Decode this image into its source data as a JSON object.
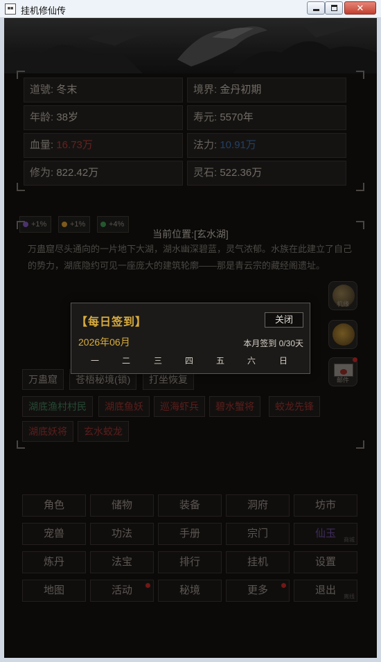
{
  "window": {
    "title": "挂机修仙传",
    "icon": "app-icon",
    "min_glyph": "—",
    "max_glyph": "□",
    "close_glyph": "✕"
  },
  "character": {
    "daohao": {
      "label": "道號:",
      "value": "冬末"
    },
    "jingjie": {
      "label": "境界:",
      "value": "金丹初期"
    },
    "age": {
      "label": "年龄:",
      "value": "38岁"
    },
    "lifespan": {
      "label": "寿元:",
      "value": "5570年"
    },
    "hp": {
      "label": "血量:",
      "value": "16.73万",
      "color": "#7a2a26"
    },
    "mana": {
      "label": "法力:",
      "value": "10.91万",
      "color": "#2b4f7b"
    },
    "cultivation": {
      "label": "修为:",
      "value": "822.42万"
    },
    "spirit_stone": {
      "label": "灵石:",
      "value": "522.36万"
    }
  },
  "buffs": [
    {
      "icon": "purple-gem-icon",
      "text": "+1%",
      "color": "#5b3f86"
    },
    {
      "icon": "gold-gem-icon",
      "text": "+1%",
      "color": "#9a6d22"
    },
    {
      "icon": "green-gem-icon",
      "text": "+4%",
      "color": "#2f6a3a"
    }
  ],
  "location": {
    "title": "当前位置:[玄水湖]",
    "description": "万蛊窟尽头通向的一片地下大湖，湖水幽深碧蓝，灵气浓郁。水族在此建立了自己的势力，湖底隐约可见一座庞大的建筑轮廓——那是青云宗的藏经阁遗址。"
  },
  "side_buttons": [
    {
      "label": "机缘",
      "icon": "fortune-icon"
    },
    {
      "label": "",
      "icon": "treasure-icon"
    },
    {
      "label": "邮件",
      "icon": "mail-icon"
    }
  ],
  "actions": [
    "万蛊窟",
    "苍梧秘境(锁)",
    "打坐恢复"
  ],
  "npcs": [
    "湖底渔村村民"
  ],
  "enemies": [
    "湖底鱼妖",
    "巡海虾兵",
    "碧水蟹将",
    "蛟龙先锋",
    "湖底妖将",
    "玄水蛟龙"
  ],
  "menu": [
    [
      "角色",
      "储物",
      "装备",
      "洞府",
      "坊市"
    ],
    [
      "宠兽",
      "功法",
      "手册",
      "宗门",
      "仙玉"
    ],
    [
      "炼丹",
      "法宝",
      "排行",
      "挂机",
      "设置"
    ],
    [
      "地图",
      "活动",
      "秘境",
      "更多",
      "退出"
    ]
  ],
  "menu_tags": {
    "xianyu": "商城",
    "exit": "离线"
  },
  "daily_signin": {
    "title": "【每日签到】",
    "close_label": "关闭",
    "month": "2026年06月",
    "progress": "本月签到 0/30天",
    "weekdays": [
      "一",
      "二",
      "三",
      "四",
      "五",
      "六",
      "日"
    ]
  }
}
